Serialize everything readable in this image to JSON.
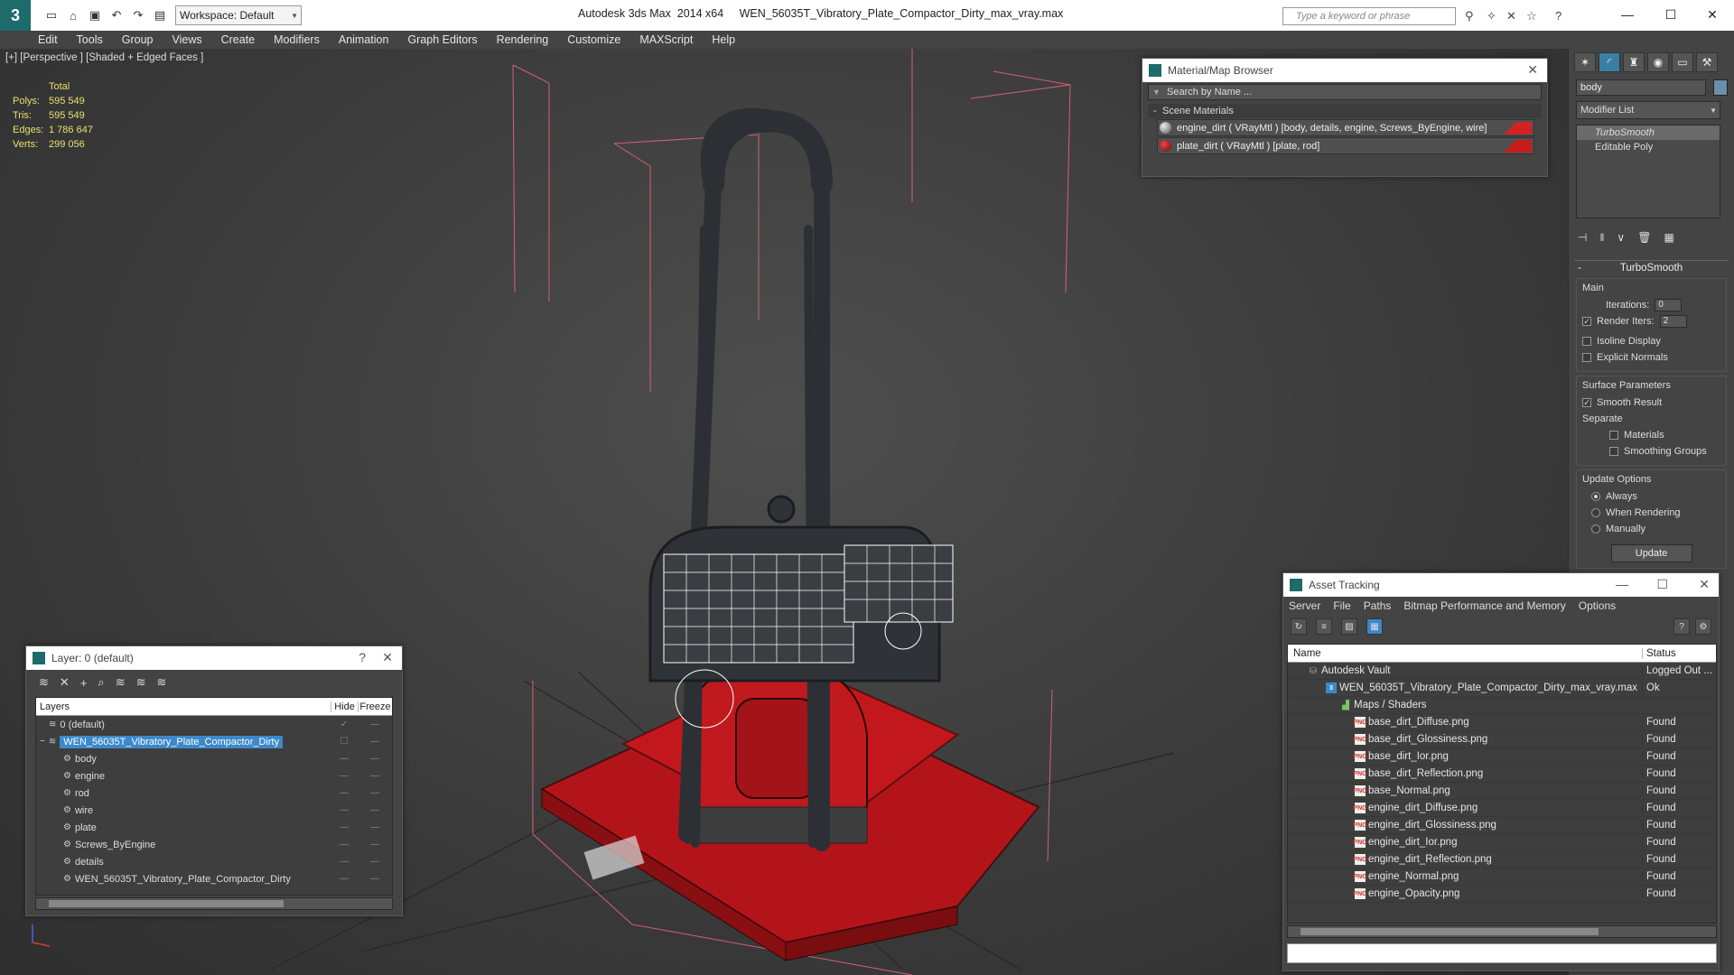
{
  "window": {
    "title": "Autodesk 3ds Max  2014 x64     WEN_56035T_Vibratory_Plate_Compactor_Dirty_max_vray.max",
    "workspace": "Workspace: Default",
    "search_placeholder": "Type a keyword or phrase"
  },
  "menu": [
    "Edit",
    "Tools",
    "Group",
    "Views",
    "Create",
    "Modifiers",
    "Animation",
    "Graph Editors",
    "Rendering",
    "Customize",
    "MAXScript",
    "Help"
  ],
  "viewport": {
    "label": "[+] [Perspective ] [Shaded + Edged Faces ]",
    "stats": {
      "total_label": "Total",
      "polys_label": "Polys:",
      "polys": "595 549",
      "tris_label": "Tris:",
      "tris": "595 549",
      "edges_label": "Edges:",
      "edges": "1 786 647",
      "verts_label": "Verts:",
      "verts": "299 056"
    }
  },
  "command_panel": {
    "object_name": "body",
    "modifier_list": "Modifier List",
    "stack": [
      "TurboSmooth",
      "Editable Poly"
    ],
    "rollout_title": "TurboSmooth",
    "main_label": "Main",
    "iterations_label": "Iterations:",
    "iterations": "0",
    "render_iters_label": "Render Iters:",
    "render_iters": "2",
    "isoline": "Isoline Display",
    "explicit_normals": "Explicit Normals",
    "surface_label": "Surface Parameters",
    "smooth_result": "Smooth Result",
    "separate_label": "Separate",
    "materials": "Materials",
    "smoothing_groups": "Smoothing Groups",
    "update_options_label": "Update Options",
    "always": "Always",
    "when_rendering": "When Rendering",
    "manually": "Manually",
    "update_button": "Update"
  },
  "material_browser": {
    "title": "Material/Map Browser",
    "search_placeholder": "Search by Name ...",
    "section": "Scene Materials",
    "materials": [
      {
        "label": "engine_dirt  ( VRayMtl ) [body, details, engine, Screws_ByEngine, wire]",
        "swatch": "#d42222"
      },
      {
        "label": "plate_dirt  ( VRayMtl ) [plate, rod]",
        "swatch": "#c81d1d"
      }
    ]
  },
  "layer_window": {
    "title": "Layer: 0 (default)",
    "columns": {
      "layers": "Layers",
      "hide": "Hide",
      "freeze": "Freeze"
    },
    "rows": [
      {
        "name": "0 (default)",
        "level": 0
      },
      {
        "name": "WEN_56035T_Vibratory_Plate_Compactor_Dirty",
        "level": 0
      },
      {
        "name": "body",
        "level": 1
      },
      {
        "name": "engine",
        "level": 1
      },
      {
        "name": "rod",
        "level": 1
      },
      {
        "name": "wire",
        "level": 1
      },
      {
        "name": "plate",
        "level": 1
      },
      {
        "name": "Screws_ByEngine",
        "level": 1
      },
      {
        "name": "details",
        "level": 1
      },
      {
        "name": "WEN_56035T_Vibratory_Plate_Compactor_Dirty",
        "level": 1
      }
    ]
  },
  "asset_tracking": {
    "title": "Asset Tracking",
    "menu": [
      "Server",
      "File",
      "Paths",
      "Bitmap Performance and Memory",
      "Options"
    ],
    "columns": {
      "name": "Name",
      "status": "Status"
    },
    "rows": [
      {
        "name": "Autodesk Vault",
        "status": "Logged Out ...",
        "icon": "vault"
      },
      {
        "name": "WEN_56035T_Vibratory_Plate_Compactor_Dirty_max_vray.max",
        "status": "Ok",
        "icon": "max"
      },
      {
        "name": "Maps / Shaders",
        "status": "",
        "icon": "folder"
      },
      {
        "name": "base_dirt_Diffuse.png",
        "status": "Found",
        "icon": "png"
      },
      {
        "name": "base_dirt_Glossiness.png",
        "status": "Found",
        "icon": "png"
      },
      {
        "name": "base_dirt_Ior.png",
        "status": "Found",
        "icon": "png"
      },
      {
        "name": "base_dirt_Reflection.png",
        "status": "Found",
        "icon": "png"
      },
      {
        "name": "base_Normal.png",
        "status": "Found",
        "icon": "png"
      },
      {
        "name": "engine_dirt_Diffuse.png",
        "status": "Found",
        "icon": "png"
      },
      {
        "name": "engine_dirt_Glossiness.png",
        "status": "Found",
        "icon": "png"
      },
      {
        "name": "engine_dirt_Ior.png",
        "status": "Found",
        "icon": "png"
      },
      {
        "name": "engine_dirt_Reflection.png",
        "status": "Found",
        "icon": "png"
      },
      {
        "name": "engine_Normal.png",
        "status": "Found",
        "icon": "png"
      },
      {
        "name": "engine_Opacity.png",
        "status": "Found",
        "icon": "png"
      }
    ]
  }
}
